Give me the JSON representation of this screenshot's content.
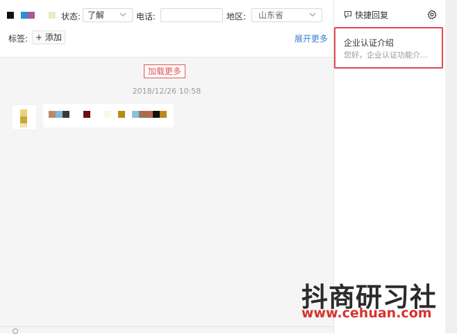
{
  "top_bar": {
    "name_mosaic_colors": [
      "#111111",
      "#ffffff",
      "#2c8fcf",
      "#a85a9a",
      "#ffffff",
      "#ffffff",
      "#e8ecc8"
    ],
    "status_label": "状态:",
    "status_value": "了解",
    "phone_label": "电话:",
    "phone_value": "",
    "region_label": "地区:",
    "region_value": "山东省",
    "tags_label": "标签:",
    "add_tag_label": "+ 添加",
    "expand_more_label": "展开更多"
  },
  "conversation": {
    "load_more_label": "加载更多",
    "timestamp": "2018/12/26 10:58",
    "message_mosaic_colors": [
      "#b98a6a",
      "#82b8d8",
      "#3a3a3a",
      "#ffffff",
      "#ffffff",
      "#6b0f0f",
      "#ffffff",
      "#ffffff",
      "#f7f7ea",
      "#ffffff",
      "#b88a18",
      "#ffffff",
      "#8ac0de",
      "#a06c5c",
      "#b46a4a",
      "#111111",
      "#b88a18"
    ]
  },
  "quick_reply": {
    "title": "快捷回复",
    "items": [
      {
        "title": "企业认证介绍",
        "preview": "您好，企业认证功能介…"
      }
    ]
  },
  "watermark": {
    "title": "抖商研习社",
    "url": "www.cehuan.com"
  },
  "colors": {
    "accent_red": "#e0474c",
    "link_blue": "#3d7bd8"
  }
}
